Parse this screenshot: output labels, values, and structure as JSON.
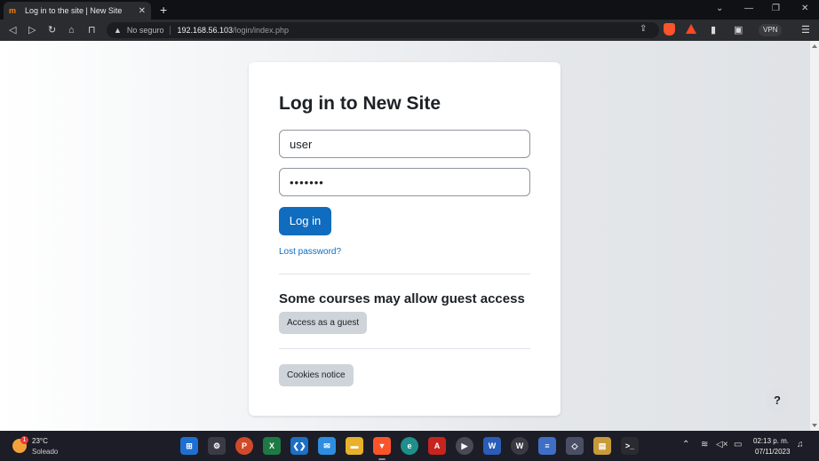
{
  "browser": {
    "tab_title": "Log in to the site | New Site",
    "tab_favicon": "m",
    "close_tab": "✕",
    "new_tab": "+",
    "security_label": "No seguro",
    "url_host": "192.168.56.103",
    "url_path": "/login/index.php",
    "vpn_label": "VPN"
  },
  "page": {
    "title": "Log in to New Site",
    "username_value": "user",
    "password_value": "•••••••",
    "login_button": "Log in",
    "lost_password": "Lost password?",
    "guest_heading": "Some courses may allow guest access",
    "guest_button": "Access as a guest",
    "cookies_button": "Cookies notice",
    "help_button": "?"
  },
  "taskbar": {
    "temperature": "23°C",
    "condition": "Soleado",
    "weather_badge": "1",
    "time": "02:13 p. m.",
    "date": "07/11/2023"
  },
  "colors": {
    "primary": "#0f6cbf",
    "secondary_button": "#ced4da",
    "brand_orange": "#f98012"
  }
}
